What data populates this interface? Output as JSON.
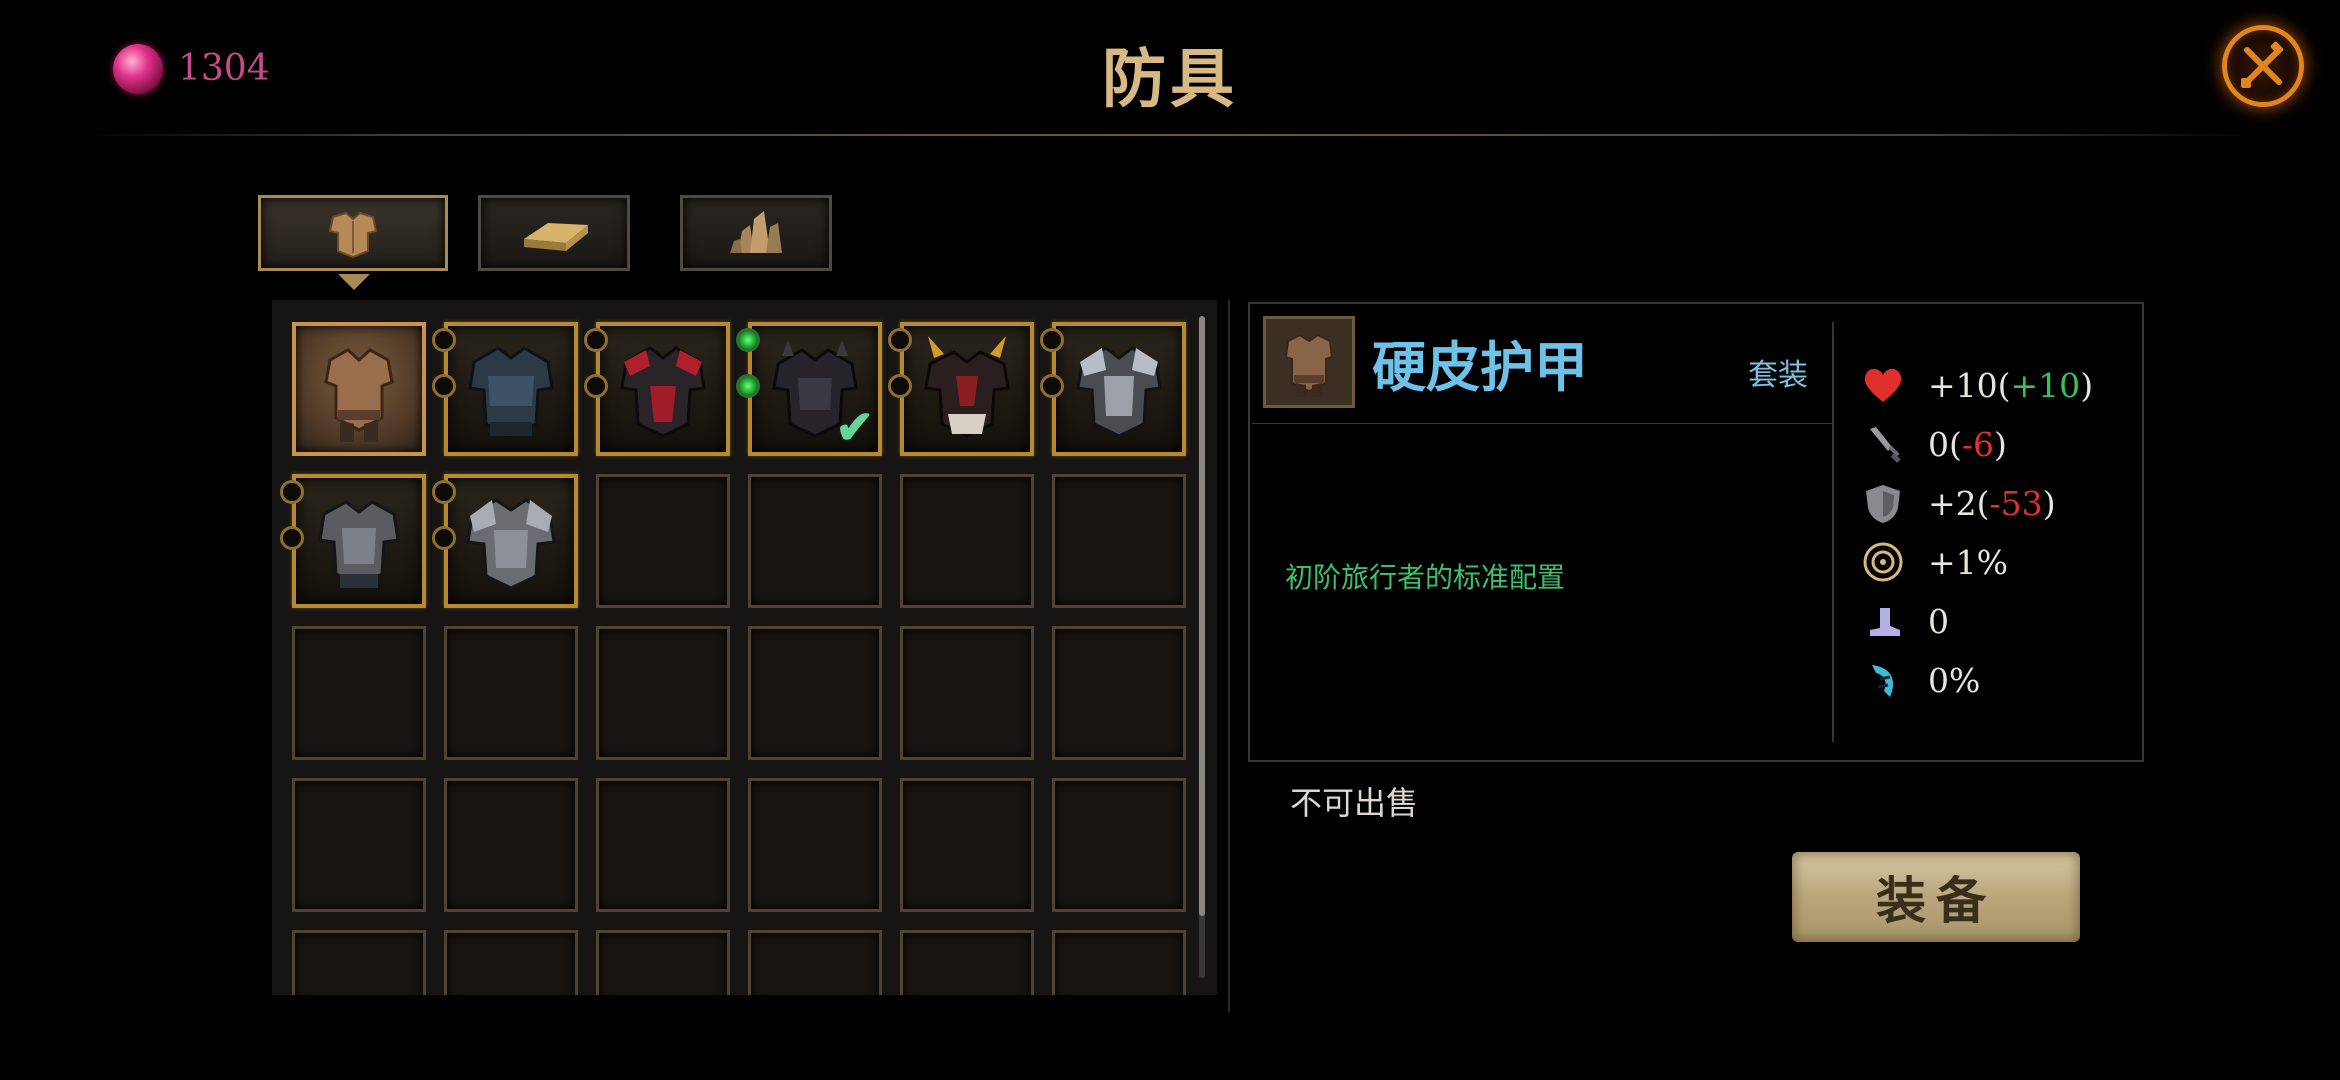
{
  "header": {
    "currency_amount": "1304",
    "title": "防具"
  },
  "tabs": [
    {
      "name": "armor-tab",
      "icon": "armor-icon",
      "active": true
    },
    {
      "name": "ingot-tab",
      "icon": "ingot-icon",
      "active": false
    },
    {
      "name": "crystal-tab",
      "icon": "crystal-icon",
      "active": false
    }
  ],
  "inventory": {
    "rows": 5,
    "columns": 6,
    "items": [
      {
        "row": 0,
        "col": 0,
        "state": "selected",
        "armor": "leather-brown",
        "sockets": 0
      },
      {
        "row": 0,
        "col": 1,
        "state": "filled",
        "armor": "dark-plate-blue",
        "sockets": 2
      },
      {
        "row": 0,
        "col": 2,
        "state": "filled",
        "armor": "red-dark-plate",
        "sockets": 2
      },
      {
        "row": 0,
        "col": 3,
        "state": "filled",
        "armor": "dark-spiked-plate",
        "sockets": 2,
        "socket_gems": [
          "green",
          "green"
        ],
        "equipped": true
      },
      {
        "row": 0,
        "col": 4,
        "state": "filled",
        "armor": "horned-demon-plate",
        "sockets": 2
      },
      {
        "row": 0,
        "col": 5,
        "state": "filled",
        "armor": "silver-plate",
        "sockets": 2
      },
      {
        "row": 1,
        "col": 0,
        "state": "filled",
        "armor": "steel-knight-plate",
        "sockets": 2
      },
      {
        "row": 1,
        "col": 1,
        "state": "filled",
        "armor": "heavy-steel-plate",
        "sockets": 2
      }
    ]
  },
  "detail": {
    "name": "硬皮护甲",
    "set_label": "套装",
    "description": "初阶旅行者的标准配置",
    "stats": [
      {
        "icon": "heart-icon",
        "value": "+10",
        "delta": "+10",
        "delta_type": "pos"
      },
      {
        "icon": "sword-icon",
        "value": "0",
        "delta": "-6",
        "delta_type": "neg"
      },
      {
        "icon": "shield-icon",
        "value": "+2",
        "delta": "-53",
        "delta_type": "neg"
      },
      {
        "icon": "crit-icon",
        "value": "+1%",
        "delta": "",
        "delta_type": ""
      },
      {
        "icon": "boot-icon",
        "value": "0",
        "delta": "",
        "delta_type": ""
      },
      {
        "icon": "claw-icon",
        "value": "0%",
        "delta": "",
        "delta_type": ""
      }
    ],
    "sell_status": "不可出售",
    "equip_label": "装备"
  },
  "colors": {
    "title": "#d9b983",
    "currency": "#c64b8a",
    "item_name": "#6cc2e8",
    "description": "#3bbf6b",
    "stat_positive": "#35c35b",
    "stat_negative": "#e0322c",
    "slot_gold": "#b8892e"
  }
}
